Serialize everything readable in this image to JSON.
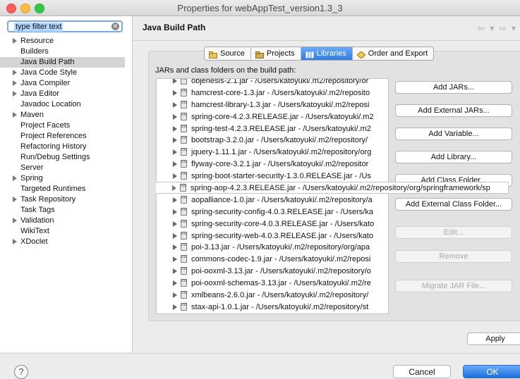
{
  "window": {
    "title": "Properties for webAppTest_version1.3_3"
  },
  "filter": {
    "value": "type filter text"
  },
  "tree": [
    {
      "label": "Resource",
      "expandable": true
    },
    {
      "label": "Builders",
      "expandable": false
    },
    {
      "label": "Java Build Path",
      "expandable": false,
      "selected": true
    },
    {
      "label": "Java Code Style",
      "expandable": true
    },
    {
      "label": "Java Compiler",
      "expandable": true
    },
    {
      "label": "Java Editor",
      "expandable": true
    },
    {
      "label": "Javadoc Location",
      "expandable": false
    },
    {
      "label": "Maven",
      "expandable": true
    },
    {
      "label": "Project Facets",
      "expandable": false
    },
    {
      "label": "Project References",
      "expandable": false
    },
    {
      "label": "Refactoring History",
      "expandable": false
    },
    {
      "label": "Run/Debug Settings",
      "expandable": false
    },
    {
      "label": "Server",
      "expandable": false
    },
    {
      "label": "Spring",
      "expandable": true
    },
    {
      "label": "Targeted Runtimes",
      "expandable": false
    },
    {
      "label": "Task Repository",
      "expandable": true
    },
    {
      "label": "Task Tags",
      "expandable": false
    },
    {
      "label": "Validation",
      "expandable": true
    },
    {
      "label": "WikiText",
      "expandable": false
    },
    {
      "label": "XDoclet",
      "expandable": true
    }
  ],
  "page_title": "Java Build Path",
  "nav_arrows": "⇦ ▾ ⇨ ▾",
  "tabs": [
    {
      "label": "Source",
      "icon": "source-folder-icon",
      "active": false
    },
    {
      "label": "Projects",
      "icon": "projects-folder-icon",
      "active": false
    },
    {
      "label": "Libraries",
      "icon": "libraries-icon",
      "active": true
    },
    {
      "label": "Order and Export",
      "icon": "order-export-icon",
      "active": false
    }
  ],
  "list_label": "JARs and class folders on the build path:",
  "jars": [
    "objenesis-2.1.jar - /Users/katoyuki/.m2/repository/or",
    "hamcrest-core-1.3.jar - /Users/katoyuki/.m2/reposito",
    "hamcrest-library-1.3.jar - /Users/katoyuki/.m2/reposi",
    "spring-core-4.2.3.RELEASE.jar - /Users/katoyuki/.m2",
    "spring-test-4.2.3.RELEASE.jar - /Users/katoyuki/.m2",
    "bootstrap-3.2.0.jar - /Users/katoyuki/.m2/repository/",
    "jquery-1.11.1.jar - /Users/katoyuki/.m2/repository/org",
    "flyway-core-3.2.1.jar - /Users/katoyuki/.m2/repositor",
    "spring-boot-starter-security-1.3.0.RELEASE.jar - /Us",
    "spring-aop-4.2.3.RELEASE.jar - /Users/katoyuki/.m2/repository/org/springframework/sp",
    "aopalliance-1.0.jar - /Users/katoyuki/.m2/repository/a",
    "spring-security-config-4.0.3.RELEASE.jar - /Users/ka",
    "spring-security-core-4.0.3.RELEASE.jar - /Users/kato",
    "spring-security-web-4.0.3.RELEASE.jar - /Users/kato",
    "poi-3.13.jar - /Users/katoyuki/.m2/repository/org/apa",
    "commons-codec-1.9.jar - /Users/katoyuki/.m2/reposi",
    "poi-ooxml-3.13.jar - /Users/katoyuki/.m2/repository/o",
    "poi-ooxml-schemas-3.13.jar - /Users/katoyuki/.m2/re",
    "xmlbeans-2.6.0.jar - /Users/katoyuki/.m2/repository/",
    "stax-api-1.0.1.jar - /Users/katoyuki/.m2/repository/st"
  ],
  "overflow_row_index": 9,
  "jar_icon_label": "010",
  "buttons": [
    {
      "label": "Add JARs...",
      "enabled": true
    },
    {
      "label": "Add External JARs...",
      "enabled": true
    },
    {
      "label": "Add Variable...",
      "enabled": true
    },
    {
      "label": "Add Library...",
      "enabled": true
    },
    {
      "label": "Add Class Folder...",
      "enabled": true
    },
    {
      "label": "Add External Class Folder...",
      "enabled": true
    },
    {
      "label": "Edit...",
      "enabled": false
    },
    {
      "label": "Remove",
      "enabled": false
    },
    {
      "label": "Migrate JAR File...",
      "enabled": false
    }
  ],
  "apply_label": "Apply",
  "help_label": "?",
  "cancel_label": "Cancel",
  "ok_label": "OK"
}
